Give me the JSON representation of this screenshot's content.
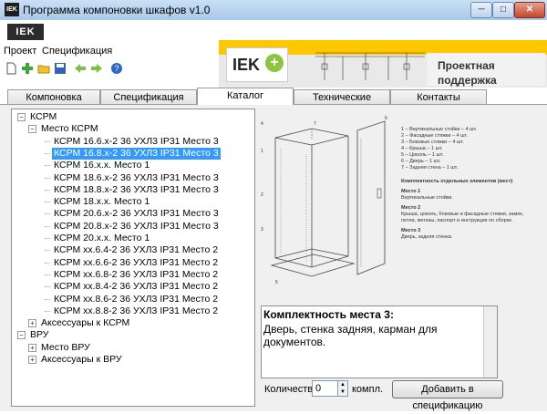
{
  "window": {
    "title": "Программа компоновки шкафов v1.0",
    "app_icon": "IEK",
    "minimize": "─",
    "maximize": "□",
    "close": "✕"
  },
  "logo": {
    "text": "IEK"
  },
  "menu": [
    "Проект",
    "Спецификация"
  ],
  "toolbar": [
    "new-icon",
    "add-icon",
    "open-icon",
    "save-icon",
    "back-icon",
    "forward-icon",
    "help-icon"
  ],
  "banner": {
    "logo_text": "IEK",
    "logo_plus": "+",
    "side_line1": "Проектная",
    "side_line2": "поддержка"
  },
  "tabs": [
    {
      "label": "Компоновка",
      "active": false
    },
    {
      "label": "Спецификация",
      "active": false
    },
    {
      "label": "Каталог",
      "active": true
    },
    {
      "label": "Технические материалы",
      "active": false
    },
    {
      "label": "Контакты",
      "active": false
    }
  ],
  "tree": [
    {
      "label": "КСРМ",
      "level": 0,
      "expander": "-"
    },
    {
      "label": "Место КСРМ",
      "level": 1,
      "expander": "-"
    },
    {
      "label": "КСРМ 16.6.х-2 36 УХЛ3 IP31 Место 3",
      "level": 2
    },
    {
      "label": "КСРМ 16.8.х-2 36 УХЛ3 IP31 Место 3",
      "level": 2,
      "selected": true
    },
    {
      "label": "КСРМ 16.х.х. Место 1",
      "level": 2
    },
    {
      "label": "КСРМ 18.6.х-2 36 УХЛ3 IP31 Место 3",
      "level": 2
    },
    {
      "label": "КСРМ 18.8.х-2 36 УХЛ3 IP31 Место 3",
      "level": 2
    },
    {
      "label": "КСРМ 18.х.х. Место 1",
      "level": 2
    },
    {
      "label": "КСРМ 20.6.х-2 36 УХЛ3 IP31 Место 3",
      "level": 2
    },
    {
      "label": "КСРМ 20.8.х-2 36 УХЛ3 IP31 Место 3",
      "level": 2
    },
    {
      "label": "КСРМ 20.х.х. Место 1",
      "level": 2
    },
    {
      "label": "КСРМ хх.6.4-2 36 УХЛ3 IP31 Место 2",
      "level": 2
    },
    {
      "label": "КСРМ хх.6.6-2 36 УХЛ3 IP31 Место 2",
      "level": 2
    },
    {
      "label": "КСРМ хх.6.8-2 36 УХЛ3 IP31 Место 2",
      "level": 2
    },
    {
      "label": "КСРМ хх.8.4-2 36 УХЛ3 IP31 Место 2",
      "level": 2
    },
    {
      "label": "КСРМ хх.8.6-2 36 УХЛ3 IP31 Место 2",
      "level": 2
    },
    {
      "label": "КСРМ хх.8.8-2 36 УХЛ3 IP31 Место 2",
      "level": 2
    },
    {
      "label": "Аксессуары к КСРМ",
      "level": 1,
      "expander": "+"
    },
    {
      "label": "ВРУ",
      "level": 0,
      "expander": "-"
    },
    {
      "label": "Место ВРУ",
      "level": 1,
      "expander": "+"
    },
    {
      "label": "Аксессуары к ВРУ",
      "level": 1,
      "expander": "+"
    }
  ],
  "legend": {
    "items": [
      "1 –   Вертикальные стойки – 4 шт.",
      "2 –   Фасадные стяжки – 4 шт.",
      "3 –   Боковые стяжки – 4 шт.",
      "4 –   Крыша – 1 шт.",
      "5 –   Цоколь – 1 шт.",
      "6 –   Дверь – 1 шт.",
      "7 –   Задняя стена – 1 шт."
    ],
    "heading": "Комплектность отдельных элементов (мест)",
    "p1_title": "Место 1",
    "p1_text": "Вертикальные стойки.",
    "p2_title": "Место 2",
    "p2_text": "Крыша, цоколь, боковые и фасадные стяжки, замок, петли, метизы, паспорт и инструкция по сборке.",
    "p3_title": "Место 3",
    "p3_text": "Дверь, задняя стенка."
  },
  "drawing_labels": [
    "4",
    "1",
    "2",
    "3",
    "5",
    "6",
    "7"
  ],
  "infobox": {
    "head": "Комплектность места 3:",
    "body": "Дверь, стенка задняя, карман для документов."
  },
  "quantity": {
    "label": "Количество",
    "value": "0",
    "unit": "компл.",
    "spin_up": "▲",
    "spin_down": "▼"
  },
  "add_button": "Добавить в спецификацию"
}
